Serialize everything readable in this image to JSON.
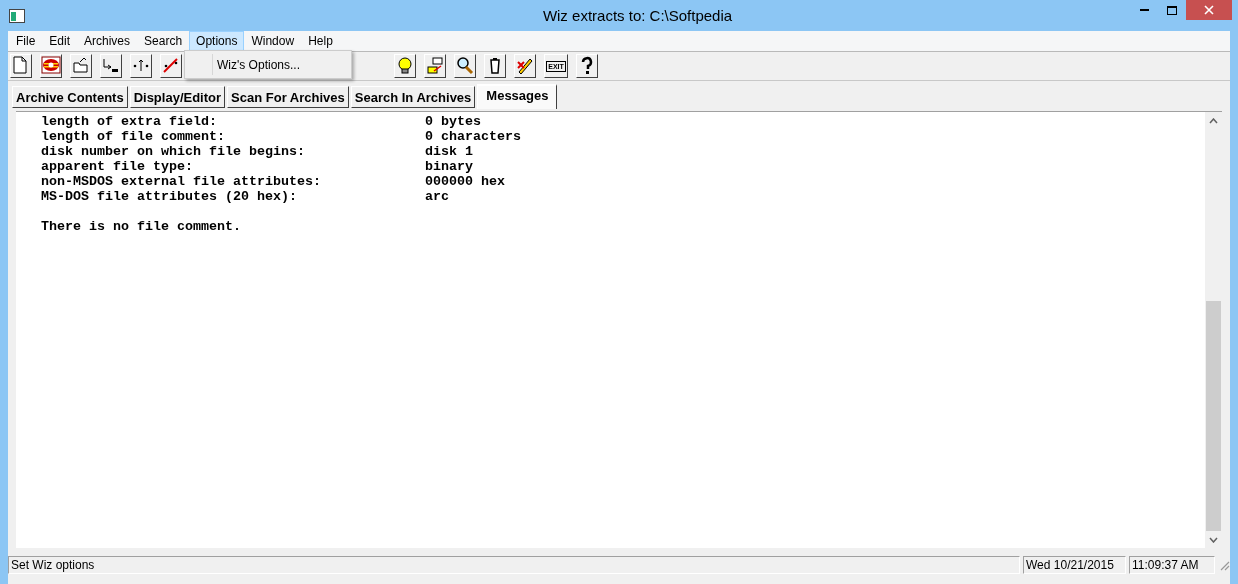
{
  "window": {
    "title": "Wiz extracts to: C:\\Softpedia"
  },
  "menu": [
    {
      "label": "File",
      "selected": false
    },
    {
      "label": "Edit",
      "selected": false
    },
    {
      "label": "Archives",
      "selected": false
    },
    {
      "label": "Search",
      "selected": false
    },
    {
      "label": "Options",
      "selected": true
    },
    {
      "label": "Window",
      "selected": false
    },
    {
      "label": "Help",
      "selected": false
    }
  ],
  "open_menu": {
    "items": [
      "Wiz's Options..."
    ]
  },
  "toolbar": {
    "left": [
      {
        "kind": "new"
      },
      {
        "kind": "logo"
      },
      {
        "kind": "open"
      },
      {
        "kind": "dir"
      },
      {
        "kind": "dots"
      },
      {
        "kind": "mark"
      }
    ],
    "right": [
      {
        "kind": "bulb"
      },
      {
        "kind": "transfer"
      },
      {
        "kind": "magnifier"
      },
      {
        "kind": "trash"
      },
      {
        "kind": "pen"
      },
      {
        "kind": "exit",
        "label": "EXIT"
      },
      {
        "kind": "help"
      }
    ]
  },
  "tabs": [
    {
      "label": "Archive Contents",
      "selected": false
    },
    {
      "label": "Display/Editor",
      "selected": false
    },
    {
      "label": "Scan For Archives",
      "selected": false
    },
    {
      "label": "Search In Archives",
      "selected": false
    },
    {
      "label": "Messages",
      "selected": true
    }
  ],
  "messages": {
    "rows": [
      {
        "label": "length of extra field:",
        "value": "0 bytes"
      },
      {
        "label": "length of file comment:",
        "value": "0 characters"
      },
      {
        "label": "disk number on which file begins:",
        "value": "disk 1"
      },
      {
        "label": "apparent file type:",
        "value": "binary"
      },
      {
        "label": "non-MSDOS external file attributes:",
        "value": "000000 hex"
      },
      {
        "label": "MS-DOS file attributes (20 hex):",
        "value": "arc"
      }
    ],
    "comment": "There is no file comment."
  },
  "status_bar": {
    "message": "Set Wiz options",
    "date": "Wed 10/21/2015",
    "time": "11:09:37 AM"
  }
}
